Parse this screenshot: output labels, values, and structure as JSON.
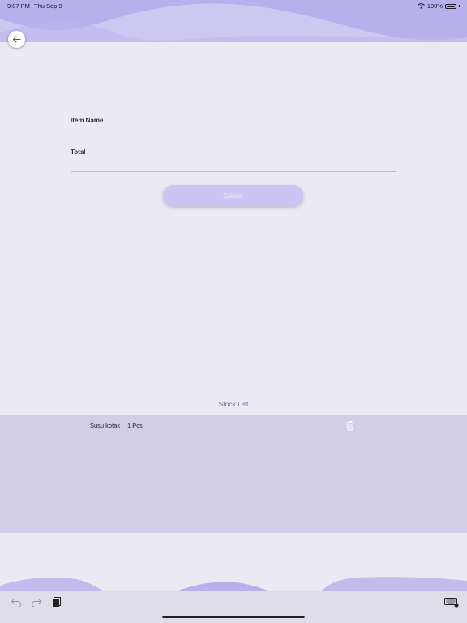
{
  "status_bar": {
    "time": "9:07 PM",
    "date": "Thu Sep 9",
    "battery": "100%"
  },
  "form": {
    "item_name_label": "Item Name",
    "item_name_value": "",
    "total_label": "Total",
    "total_value": "",
    "submit_label": "Submit"
  },
  "stock": {
    "title": "Stock List",
    "items": [
      {
        "name": "Susu kotak",
        "total": "1 Pcs"
      }
    ]
  },
  "colors": {
    "accent": "#c4bdf0",
    "wave": "#b7b0ec",
    "panel": "#d2cee8",
    "background": "#ebe9f2"
  },
  "icons": [
    "back-arrow-icon",
    "wifi-icon",
    "battery-icon",
    "trash-icon",
    "undo-icon",
    "redo-icon",
    "paste-icon",
    "keyboard-icon"
  ]
}
